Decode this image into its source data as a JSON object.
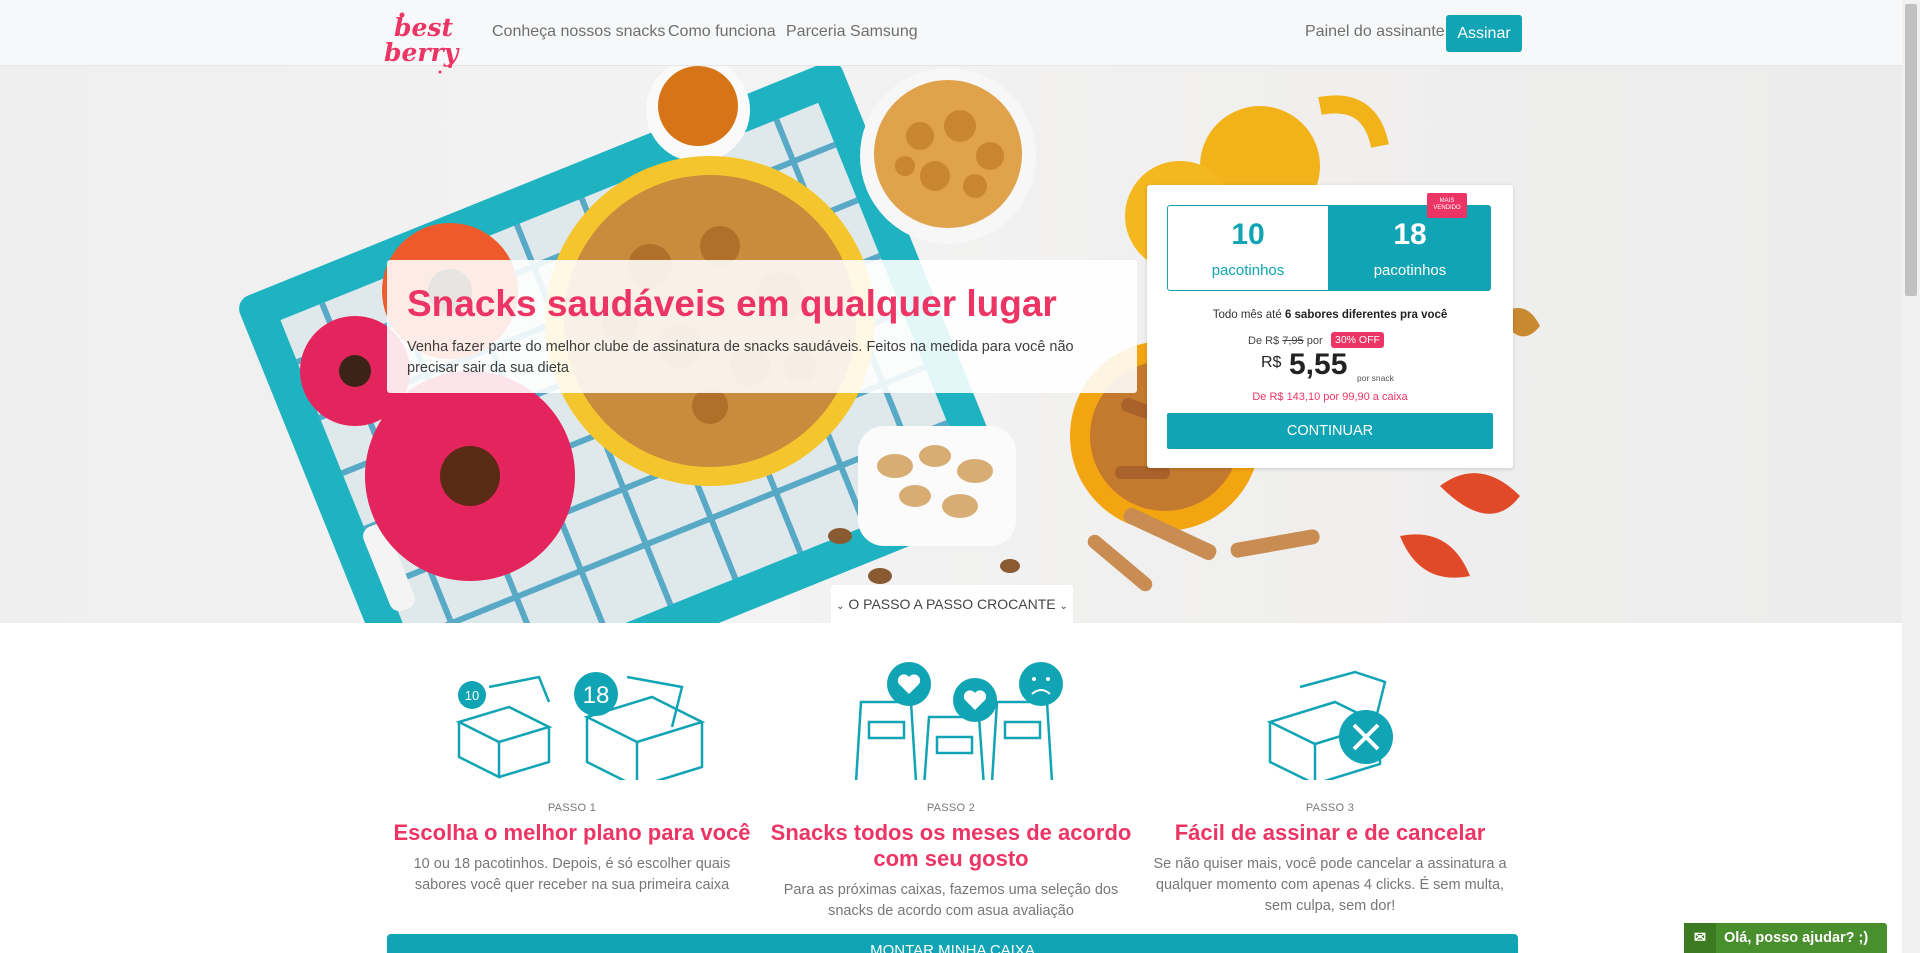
{
  "brand": {
    "logo_text_1": "best",
    "logo_text_2": "berry",
    "pink": "#ec3564",
    "teal": "#10a4b4"
  },
  "nav": {
    "links": [
      "Conheça nossos snacks",
      "Como funciona",
      "Parceria Samsung"
    ],
    "painel": "Painel do assinante",
    "assinar": "Assinar"
  },
  "hero": {
    "title": "Snacks saudáveis em qualquer lugar",
    "subtitle_line1": "Venha fazer parte do melhor clube de assinatura de snacks saudáveis. Feitos na medida para você não",
    "subtitle_line2": "precisar sair da sua dieta"
  },
  "plan": {
    "options": [
      {
        "num": "10",
        "label": "pacotinhos",
        "selected": false
      },
      {
        "num": "18",
        "label": "pacotinhos",
        "selected": true
      }
    ],
    "badge": "MAIS VENDIDO",
    "desc_pre": "Todo mês até ",
    "desc_bold": "6 sabores diferentes pra você",
    "old_pre": "De R$ ",
    "old_value": "7,95",
    "old_post": " por",
    "off": "30% OFF",
    "currency": "R$",
    "price": "5,55",
    "unit": "por snack",
    "box_price": "De R$ 143,10 por 99,90 a caixa",
    "cta": "CONTINUAR"
  },
  "passo_tab": "O PASSO A PASSO CROCANTE",
  "steps": [
    {
      "label": "PASSO 1",
      "title_1": "Escolha o melhor plano para você",
      "title_2": "",
      "desc_1": "10 ou 18 pacotinhos. Depois, é só escolher quais",
      "desc_2": "sabores você quer receber na sua primeira caixa",
      "desc_3": "",
      "icon_nums": [
        "10",
        "18"
      ]
    },
    {
      "label": "PASSO 2",
      "title_1": "Snacks todos os meses de acordo",
      "title_2": "com seu gosto",
      "desc_1": "Para as próximas caixas, fazemos uma seleção dos",
      "desc_2": "snacks de acordo com asua avaliação",
      "desc_3": ""
    },
    {
      "label": "PASSO 3",
      "title_1": "Fácil de assinar e de cancelar",
      "title_2": "",
      "desc_1": "Se não quiser mais, você pode cancelar a assinatura a",
      "desc_2": "qualquer momento com apenas 4 clicks. É sem multa,",
      "desc_3": "sem culpa, sem dor!"
    }
  ],
  "montar": "MONTAR MINHA CAIXA",
  "chat": "Olá, posso ajudar? ;)"
}
